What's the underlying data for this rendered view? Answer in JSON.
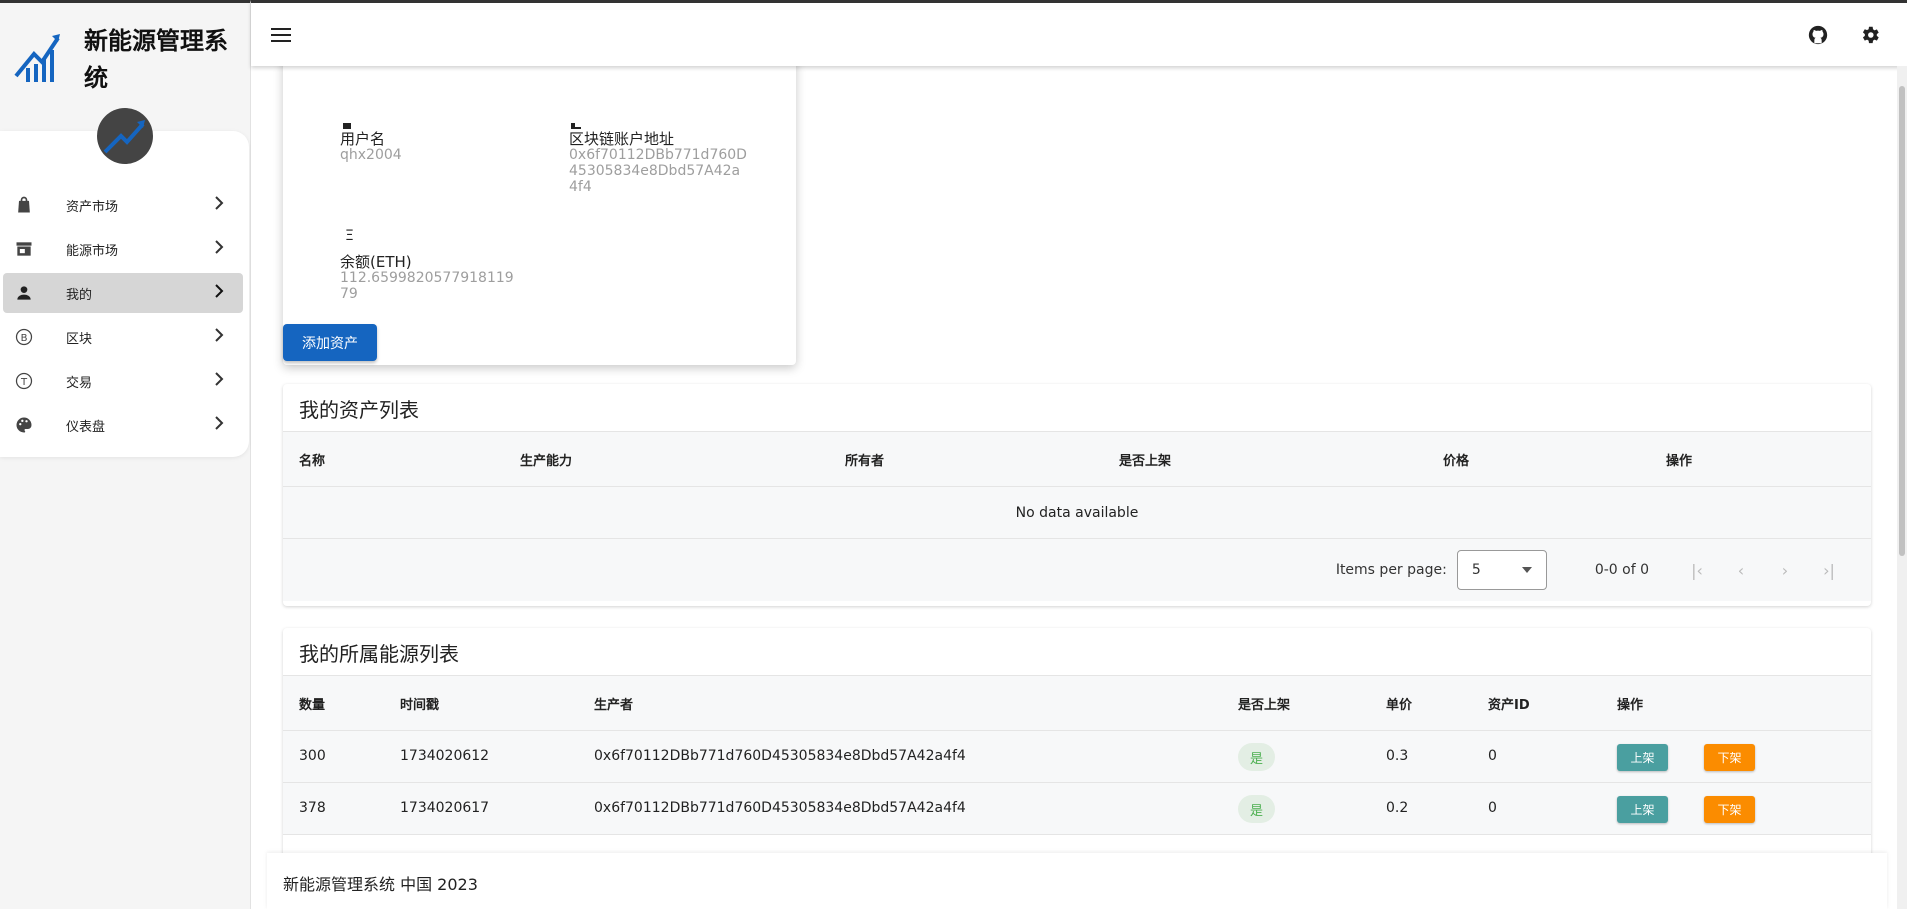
{
  "app": {
    "title": "新能源管理系统"
  },
  "colors": {
    "primary": "#1565c0",
    "success": "#4caf50",
    "teal": "#4a9fa0",
    "orange": "#fb8c00"
  },
  "sidebar": {
    "items": [
      {
        "label": "资产市场",
        "icon": "shopping-bag-icon"
      },
      {
        "label": "能源市场",
        "icon": "store-icon"
      },
      {
        "label": "我的",
        "icon": "person-icon",
        "active": true
      },
      {
        "label": "区块",
        "icon": "circle-b-icon"
      },
      {
        "label": "交易",
        "icon": "circle-t-icon"
      },
      {
        "label": "仪表盘",
        "icon": "palette-icon"
      }
    ]
  },
  "header": {
    "icons": [
      "menu-icon",
      "github-icon",
      "gear-icon"
    ]
  },
  "profile": {
    "username_label": "用户名",
    "username": "qhx2004",
    "address_label": "区块链账户地址",
    "address": "0x6f70112DBb771d760D45305834e8Dbd57A42a4f4",
    "address_lines": [
      "0x6f70112DBb771d760D",
      "45305834e8Dbd57A42a",
      "4f4"
    ],
    "balance_symbol": "Ξ",
    "balance_label": "余额(ETH)",
    "balance": "112.659982057791811979",
    "balance_lines": [
      "112.6599820577918119",
      "79"
    ]
  },
  "add_asset_button": "添加资产",
  "asset_table": {
    "title": "我的资产列表",
    "headers": [
      "名称",
      "生产能力",
      "所有者",
      "是否上架",
      "价格",
      "操作"
    ],
    "empty_text": "No data available",
    "items_per_page_label": "Items per page:",
    "items_per_page": "5",
    "range_text": "0-0 of 0"
  },
  "energy_table": {
    "title": "我的所属能源列表",
    "headers": [
      "数量",
      "时间戳",
      "生产者",
      "是否上架",
      "单价",
      "资产ID",
      "操作"
    ],
    "rows": [
      {
        "amount": "300",
        "timestamp": "1734020612",
        "producer": "0x6f70112DBb771d760D45305834e8Dbd57A42a4f4",
        "listed": "是",
        "price": "0.3",
        "asset_id": "0",
        "up": "上架",
        "down": "下架"
      },
      {
        "amount": "378",
        "timestamp": "1734020617",
        "producer": "0x6f70112DBb771d760D45305834e8Dbd57A42a4f4",
        "listed": "是",
        "price": "0.2",
        "asset_id": "0",
        "up": "上架",
        "down": "下架"
      }
    ]
  },
  "footer": {
    "text": "新能源管理系统 中国 2023"
  }
}
